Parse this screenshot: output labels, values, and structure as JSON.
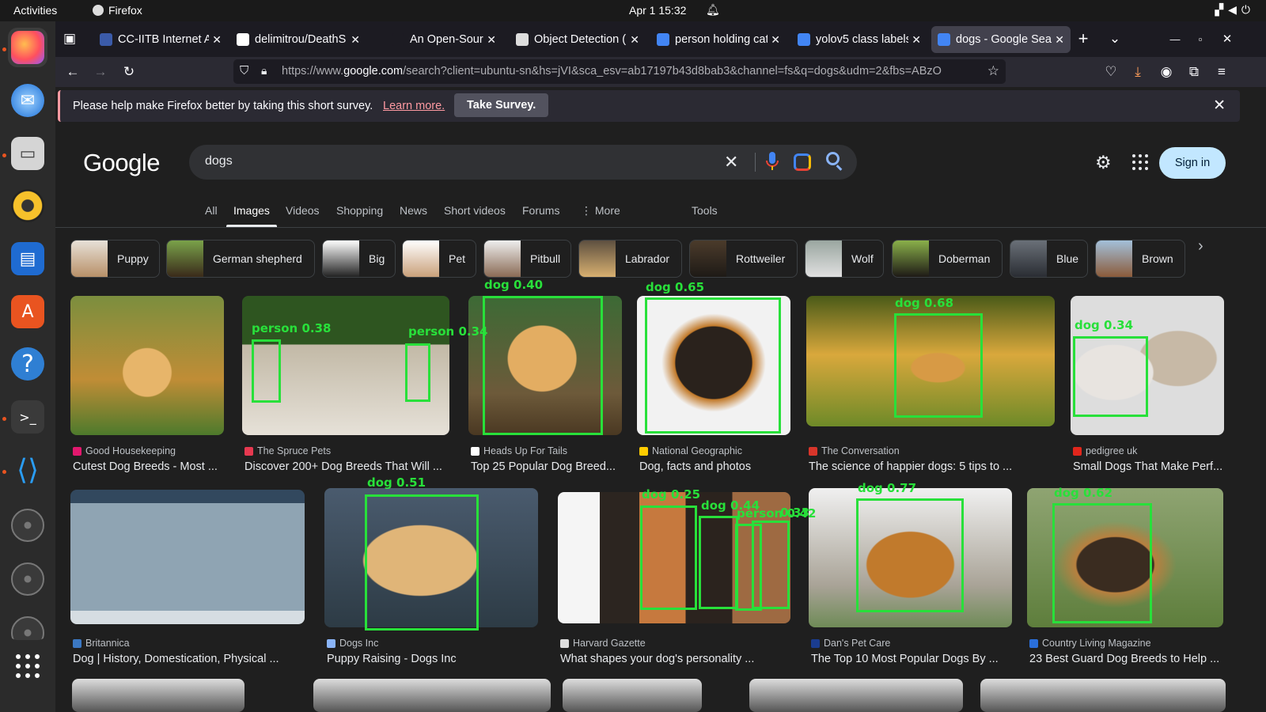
{
  "os": {
    "activities": "Activities",
    "app_name": "Firefox",
    "clock": "Apr 1  15:32"
  },
  "tabs": [
    {
      "title": "CC-IITB Internet Ac",
      "favicon_color": "#3b5ba9"
    },
    {
      "title": "delimitrou/DeathS",
      "favicon_color": "#ffffff"
    },
    {
      "title": "An Open-Source B",
      "favicon_color": "#1c1b22"
    },
    {
      "title": "Object Detection (",
      "favicon_color": "#dddddd"
    },
    {
      "title": "person holding cat",
      "favicon_color": "#4285f4"
    },
    {
      "title": "yolov5 class labels",
      "favicon_color": "#4285f4"
    },
    {
      "title": "dogs - Google Sear",
      "favicon_color": "#4285f4"
    }
  ],
  "url": {
    "prefix": "https://www.",
    "domain": "google.com",
    "rest": "/search?client=ubuntu-sn&hs=jVI&sca_esv=ab17197b43d8bab3&channel=fs&q=dogs&udm=2&fbs=ABzO"
  },
  "survey": {
    "message": "Please help make Firefox better by taking this short survey.",
    "learn_more": "Learn more.",
    "take_survey": "Take Survey."
  },
  "google": {
    "logo": "Google",
    "query": "dogs",
    "sign_in": "Sign in",
    "nav": [
      "All",
      "Images",
      "Videos",
      "Shopping",
      "News",
      "Short videos",
      "Forums",
      "More",
      "Tools"
    ],
    "more_prefix": "⋮",
    "chips": [
      "Puppy",
      "German shepherd",
      "Big",
      "Pet",
      "Pitbull",
      "Labrador",
      "Rottweiler",
      "Wolf",
      "Doberman",
      "Blue",
      "Brown"
    ],
    "results": [
      {
        "source": "Good Housekeeping",
        "title": "Cutest Dog Breeds - Most ...",
        "src_color": "#e2186e"
      },
      {
        "source": "The Spruce Pets",
        "title": "Discover 200+ Dog Breeds That Will ...",
        "src_color": "#e63950"
      },
      {
        "source": "Heads Up For Tails",
        "title": "Top 25 Popular Dog Breed...",
        "src_color": "#ffffff"
      },
      {
        "source": "National Geographic",
        "title": "Dog, facts and photos",
        "src_color": "#ffcd00"
      },
      {
        "source": "The Conversation",
        "title": "The science of happier dogs: 5 tips to ...",
        "src_color": "#d8352a"
      },
      {
        "source": "pedigree uk",
        "title": "Small Dogs That Make Perf...",
        "src_color": "#e1261c"
      },
      {
        "source": "Britannica",
        "title": "Dog | History, Domestication, Physical ...",
        "src_color": "#3b78c3"
      },
      {
        "source": "Dogs Inc",
        "title": "Puppy Raising - Dogs Inc",
        "src_color": "#8ab4f8"
      },
      {
        "source": "Harvard Gazette",
        "title": "What shapes your dog's personality ...",
        "src_color": "#dddddd"
      },
      {
        "source": "Dan's Pet Care",
        "title": "The Top 10 Most Popular Dogs By ...",
        "src_color": "#1a3c8f"
      },
      {
        "source": "Country Living Magazine",
        "title": "23 Best Guard Dog Breeds to Help ...",
        "src_color": "#2a6fdb"
      }
    ],
    "detections": [
      "person 0.38",
      "person 0.34",
      "dog 0.40",
      "dog 0.65",
      "dog 0.68",
      "dog 0.34",
      "dog 0.51",
      "dog 0.25",
      "dog 0.44",
      "person 0.42",
      "0.33",
      "dog 0.77",
      "dog 0.62"
    ]
  }
}
